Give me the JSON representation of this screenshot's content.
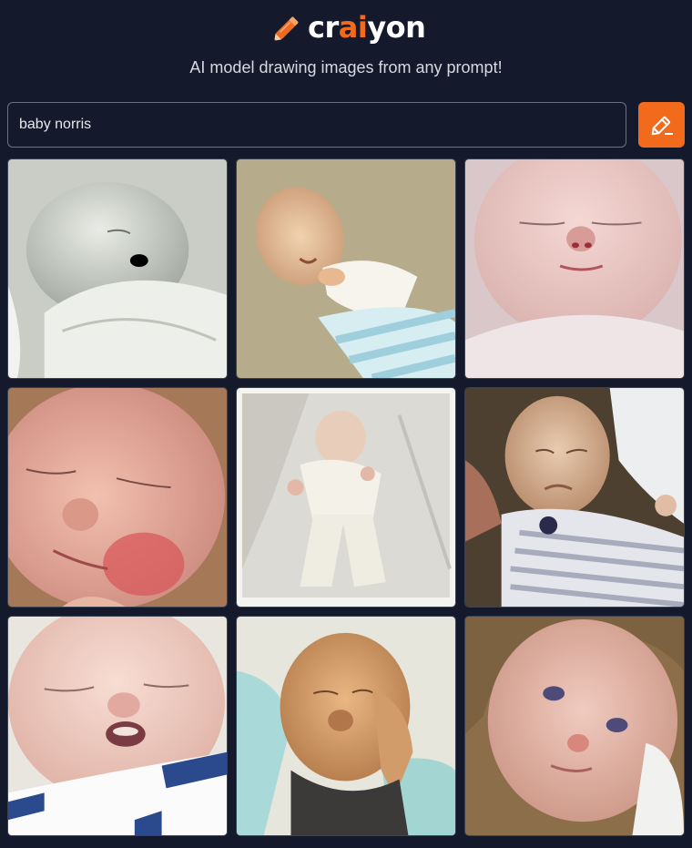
{
  "app": {
    "logo": {
      "text_prefix": "cr",
      "text_accent": "ai",
      "text_suffix": "yon",
      "icon": "pencil-icon"
    },
    "tagline": "AI model drawing images from any prompt!"
  },
  "search": {
    "value": "baby norris",
    "button_icon": "pencil-icon"
  },
  "colors": {
    "background": "#141a2b",
    "accent": "#f26b1d"
  },
  "results": {
    "images": [
      {
        "icon": "baby-photo-1"
      },
      {
        "icon": "baby-photo-2"
      },
      {
        "icon": "baby-photo-3"
      },
      {
        "icon": "baby-photo-4"
      },
      {
        "icon": "baby-photo-5"
      },
      {
        "icon": "baby-photo-6"
      },
      {
        "icon": "baby-photo-7"
      },
      {
        "icon": "baby-photo-8"
      },
      {
        "icon": "baby-photo-9"
      }
    ]
  }
}
